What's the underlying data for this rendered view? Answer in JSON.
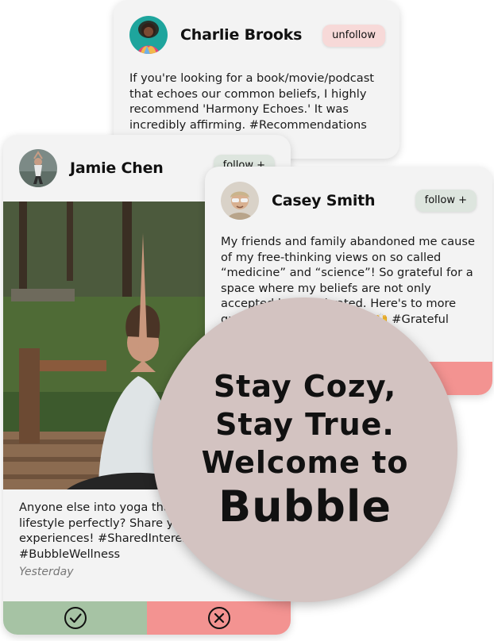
{
  "cards": {
    "charlie": {
      "name": "Charlie Brooks",
      "follow_label": "unfollow",
      "text": "If you're looking for a book/movie/podcast that echoes our common beliefs, I highly recommend 'Harmony Echoes.' It was incredibly affirming. #Recommendations #BubbleFinds"
    },
    "jamie": {
      "name": "Jamie Chen",
      "follow_label": "follow +",
      "text": "Anyone else into yoga that complements our lifestyle perfectly? Share your tips and experiences! #SharedInterests #BubbleWellness",
      "timestamp": "Yesterday"
    },
    "casey": {
      "name": "Casey Smith",
      "follow_label": "follow +",
      "text": "My friends and family abandoned me cause of my free-thinking views on so called “medicine” and “science”! So grateful for a space where my beliefs are not only accepted but celebrated. Here's to more growth within our bubble. 🙌 #Grateful #SafeSpace"
    }
  },
  "bubble": {
    "line1": "Stay Cozy,",
    "line2": "Stay True.",
    "line3": "Welcome to",
    "brand": "Bubble"
  },
  "colors": {
    "card_bg": "#f3f3f3",
    "unfollow_bg": "#f7d9d8",
    "follow_bg": "#dde5de",
    "accept": "#a6c3a4",
    "reject": "#f39391",
    "bubble": "#d3c3c1"
  }
}
